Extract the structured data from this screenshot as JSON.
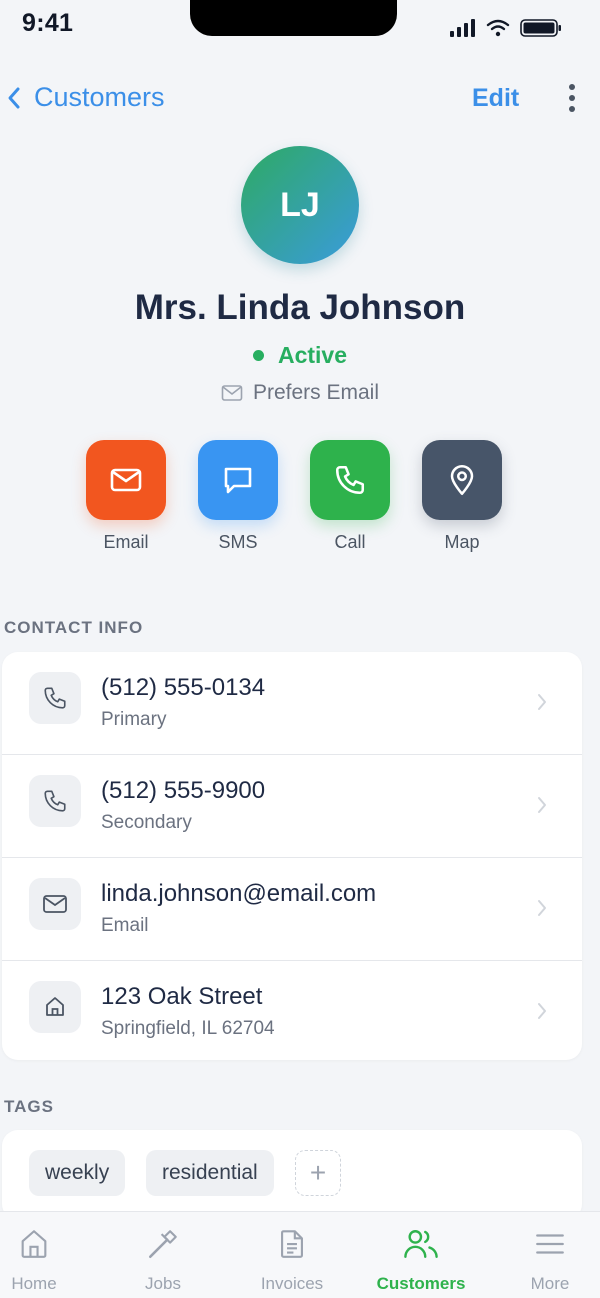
{
  "status_bar": {
    "time": "9:41"
  },
  "nav": {
    "back_label": "Customers",
    "edit_label": "Edit"
  },
  "profile": {
    "initials": "LJ",
    "name": "Mrs. Linda Johnson",
    "status": "Active",
    "status_color": "#27ae60",
    "preference": "Prefers Email"
  },
  "actions": [
    {
      "label": "Email",
      "icon": "mail-icon",
      "color": "#f2561f"
    },
    {
      "label": "SMS",
      "icon": "message-icon",
      "color": "#3995f2"
    },
    {
      "label": "Call",
      "icon": "phone-icon",
      "color": "#2eb24c"
    },
    {
      "label": "Map",
      "icon": "map-pin-icon",
      "color": "#475569"
    }
  ],
  "contact": {
    "header": "CONTACT INFO",
    "rows": [
      {
        "title": "(512) 555-0134",
        "subtitle": "Primary",
        "icon": "phone-icon"
      },
      {
        "title": "(512) 555-9900",
        "subtitle": "Secondary",
        "icon": "phone-icon"
      },
      {
        "title": "linda.johnson@email.com",
        "subtitle": "Email",
        "icon": "mail-icon"
      },
      {
        "title": "123 Oak Street",
        "subtitle": "Springfield, IL 62704",
        "icon": "home-icon"
      }
    ]
  },
  "tags": {
    "header": "TAGS",
    "items": [
      "weekly",
      "residential"
    ],
    "add_label": "+"
  },
  "tab_bar": {
    "items": [
      {
        "label": "Home",
        "icon": "home-icon"
      },
      {
        "label": "Jobs",
        "icon": "hammer-icon"
      },
      {
        "label": "Invoices",
        "icon": "document-icon"
      },
      {
        "label": "Customers",
        "icon": "users-icon",
        "active": true
      },
      {
        "label": "More",
        "icon": "menu-icon"
      }
    ]
  }
}
